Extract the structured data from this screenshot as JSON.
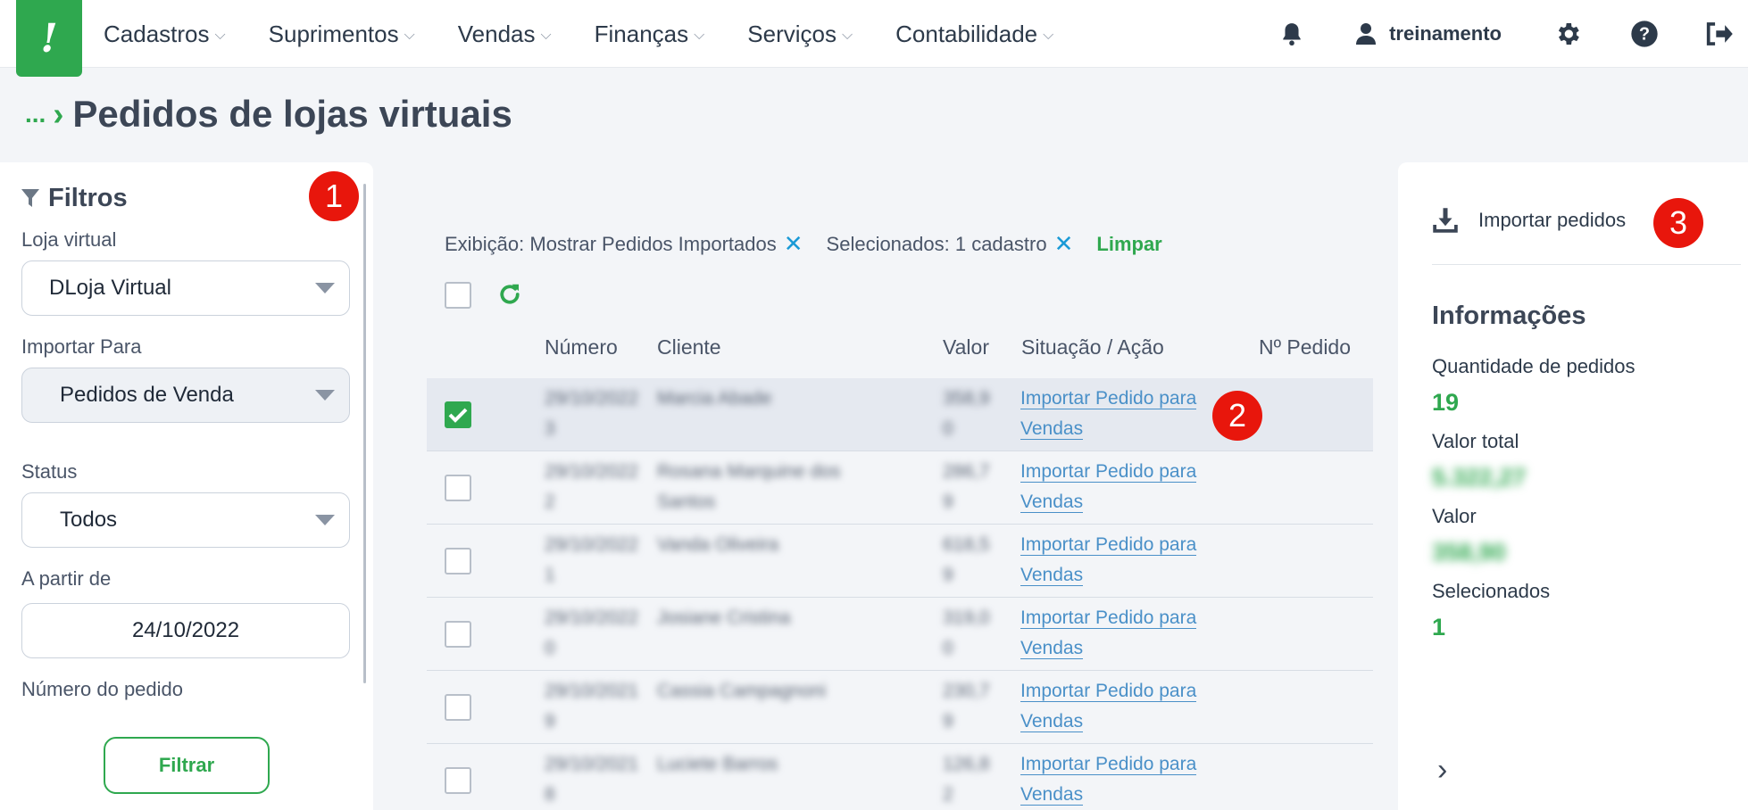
{
  "nav": {
    "logo": "!",
    "items": [
      "Cadastros",
      "Suprimentos",
      "Vendas",
      "Finanças",
      "Serviços",
      "Contabilidade"
    ],
    "user": "treinamento"
  },
  "breadcrumb": {
    "dots": "...",
    "title": "Pedidos de lojas virtuais"
  },
  "filters": {
    "title": "Filtros",
    "loja_label": "Loja virtual",
    "loja_value": "DLoja Virtual",
    "importar_label": "Importar Para",
    "importar_value": "Pedidos de Venda",
    "status_label": "Status",
    "status_value": "Todos",
    "data_label": "A partir de",
    "data_value": "24/10/2022",
    "numero_label": "Número do pedido",
    "button": "Filtrar"
  },
  "badges": [
    "1",
    "2",
    "3"
  ],
  "chips": {
    "exibicao": "Exibição: Mostrar Pedidos Importados",
    "selecionados": "Selecionados: 1 cadastro",
    "x": "✕",
    "limpar": "Limpar"
  },
  "table": {
    "columns": [
      "Número",
      "Cliente",
      "Valor",
      "Situação / Ação",
      "Nº Pedido"
    ],
    "action_line1": "Importar Pedido para",
    "action_line2": "Vendas",
    "rows": [
      {
        "numero": [
          "29/10/2022",
          "3"
        ],
        "cliente": [
          "Marcia Abade",
          ""
        ],
        "valor": [
          "358,9",
          "0"
        ],
        "selected": true
      },
      {
        "numero": [
          "29/10/2022",
          "2"
        ],
        "cliente": [
          "Rosana Marquine dos",
          "Santos"
        ],
        "valor": [
          "286,7",
          "9"
        ],
        "selected": false
      },
      {
        "numero": [
          "29/10/2022",
          "1"
        ],
        "cliente": [
          "Vanda Oliveira",
          ""
        ],
        "valor": [
          "618,5",
          "9"
        ],
        "selected": false
      },
      {
        "numero": [
          "29/10/2022",
          "0"
        ],
        "cliente": [
          "Josiane Cristina",
          ""
        ],
        "valor": [
          "319,0",
          "0"
        ],
        "selected": false
      },
      {
        "numero": [
          "29/10/2021",
          "9"
        ],
        "cliente": [
          "Cassia Campagnoni",
          ""
        ],
        "valor": [
          "230,7",
          "9"
        ],
        "selected": false
      },
      {
        "numero": [
          "29/10/2021",
          "8"
        ],
        "cliente": [
          "Luciete Barros",
          ""
        ],
        "valor": [
          "126,8",
          "2"
        ],
        "selected": false
      }
    ]
  },
  "side": {
    "import_button": "Importar pedidos",
    "info_title": "Informações",
    "qtd_label": "Quantidade de pedidos",
    "qtd_value": "19",
    "total_label": "Valor total",
    "total_value": "5.322,27",
    "valor_label": "Valor",
    "valor_value": "358,90",
    "sel_label": "Selecionados",
    "sel_value": "1",
    "chevron": "›"
  },
  "colors": {
    "brand": "#2fa84f",
    "link": "#4a90c8",
    "badge": "#e8160c",
    "chip_x": "#1a9ad6"
  },
  "icons": [
    "bell-icon",
    "user-icon",
    "gear-icon",
    "help-icon",
    "logout-icon",
    "filter-icon",
    "refresh-icon",
    "download-icon"
  ]
}
